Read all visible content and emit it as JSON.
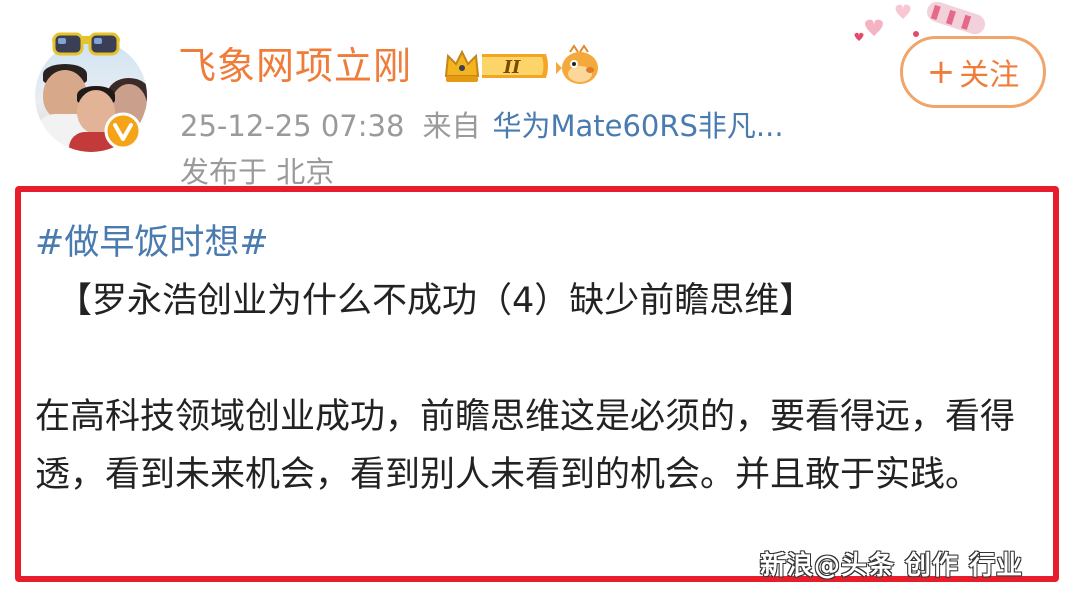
{
  "post": {
    "author": {
      "name": "飞象网项立刚",
      "level_badge": "II"
    },
    "meta": {
      "timestamp": "25-12-25 07:38",
      "source_prefix": "来自",
      "device": "华为Mate60RS非凡...",
      "location": "发布于 北京"
    },
    "follow_button": {
      "icon": "+",
      "label": "关注"
    },
    "content": {
      "hashtag": "#做早饭时想#",
      "title": "【罗永浩创业为什么不成功（4）缺少前瞻思维】",
      "body": "在高科技领域创业成功，前瞻思维这是必须的，要看得远，看得透，看到未来机会，看到别人未看到的机会。并且敢于实践。"
    }
  },
  "colors": {
    "username": "#f07c3a",
    "link": "#4a7bb0",
    "meta": "#9a9a9a",
    "highlight_border": "#e81d2c",
    "follow_border": "#f2a56b"
  },
  "icons": {
    "avatar_badge": "verified-v-icon",
    "crown": "crown-level-icon",
    "emoji": "pufferfish-emoji-icon",
    "decoration": "hearts-decoration-icon"
  }
}
